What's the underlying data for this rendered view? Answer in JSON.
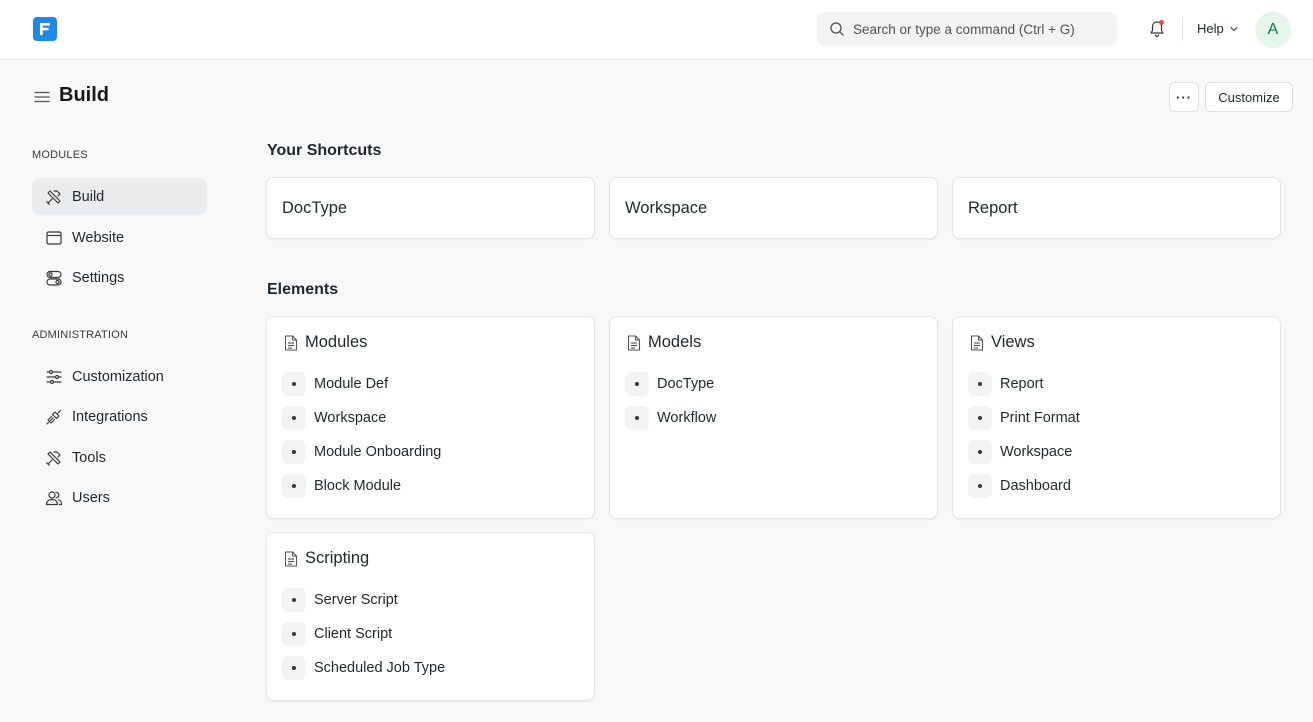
{
  "navbar": {
    "search_placeholder": "Search or type a command (Ctrl + G)",
    "help_label": "Help",
    "avatar_initial": "A"
  },
  "page": {
    "title": "Build",
    "more_label": "···",
    "customize_label": "Customize"
  },
  "sidebar": {
    "sections": [
      {
        "label": "MODULES",
        "items": [
          {
            "label": "Build",
            "icon": "build-icon",
            "active": true
          },
          {
            "label": "Website",
            "icon": "website-icon",
            "active": false
          },
          {
            "label": "Settings",
            "icon": "settings-icon",
            "active": false
          }
        ]
      },
      {
        "label": "ADMINISTRATION",
        "items": [
          {
            "label": "Customization",
            "icon": "customization-icon",
            "active": false
          },
          {
            "label": "Integrations",
            "icon": "integrations-icon",
            "active": false
          },
          {
            "label": "Tools",
            "icon": "tools-icon",
            "active": false
          },
          {
            "label": "Users",
            "icon": "users-icon",
            "active": false
          }
        ]
      }
    ]
  },
  "shortcuts": {
    "title": "Your Shortcuts",
    "items": [
      "DocType",
      "Workspace",
      "Report"
    ]
  },
  "elements": {
    "title": "Elements",
    "cards": [
      {
        "title": "Modules",
        "links": [
          "Module Def",
          "Workspace",
          "Module Onboarding",
          "Block Module"
        ]
      },
      {
        "title": "Models",
        "links": [
          "DocType",
          "Workflow"
        ]
      },
      {
        "title": "Views",
        "links": [
          "Report",
          "Print Format",
          "Workspace",
          "Dashboard"
        ]
      },
      {
        "title": "Scripting",
        "links": [
          "Server Script",
          "Client Script",
          "Scheduled Job Type"
        ]
      }
    ]
  },
  "colors": {
    "brand": "#1e88e5",
    "notification_dot": "#e24c4c",
    "avatar_bg": "#e4f5e9",
    "avatar_text": "#16794c"
  }
}
